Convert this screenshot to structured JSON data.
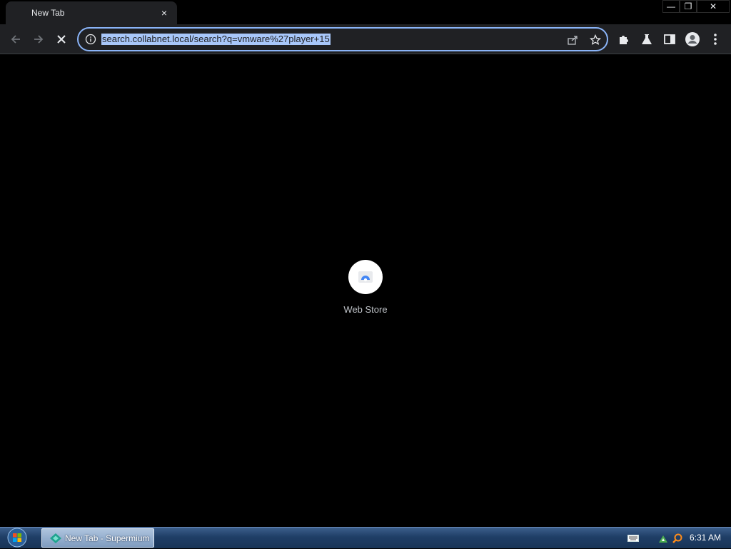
{
  "tab": {
    "title": "New Tab",
    "close": "×"
  },
  "window_controls": {
    "minimize": "—",
    "restore": "❐",
    "close": "✕"
  },
  "omnibox": {
    "url": "search.collabnet.local/search?q=vmware%27player+15"
  },
  "shortcuts": [
    {
      "label": "Web Store"
    }
  ],
  "taskbar": {
    "task_label": "New Tab - Supermium",
    "clock": "6:31 AM"
  },
  "colors": {
    "accent": "#8ab4f8",
    "selection": "#a8c7fa",
    "toolbar": "#202124"
  }
}
